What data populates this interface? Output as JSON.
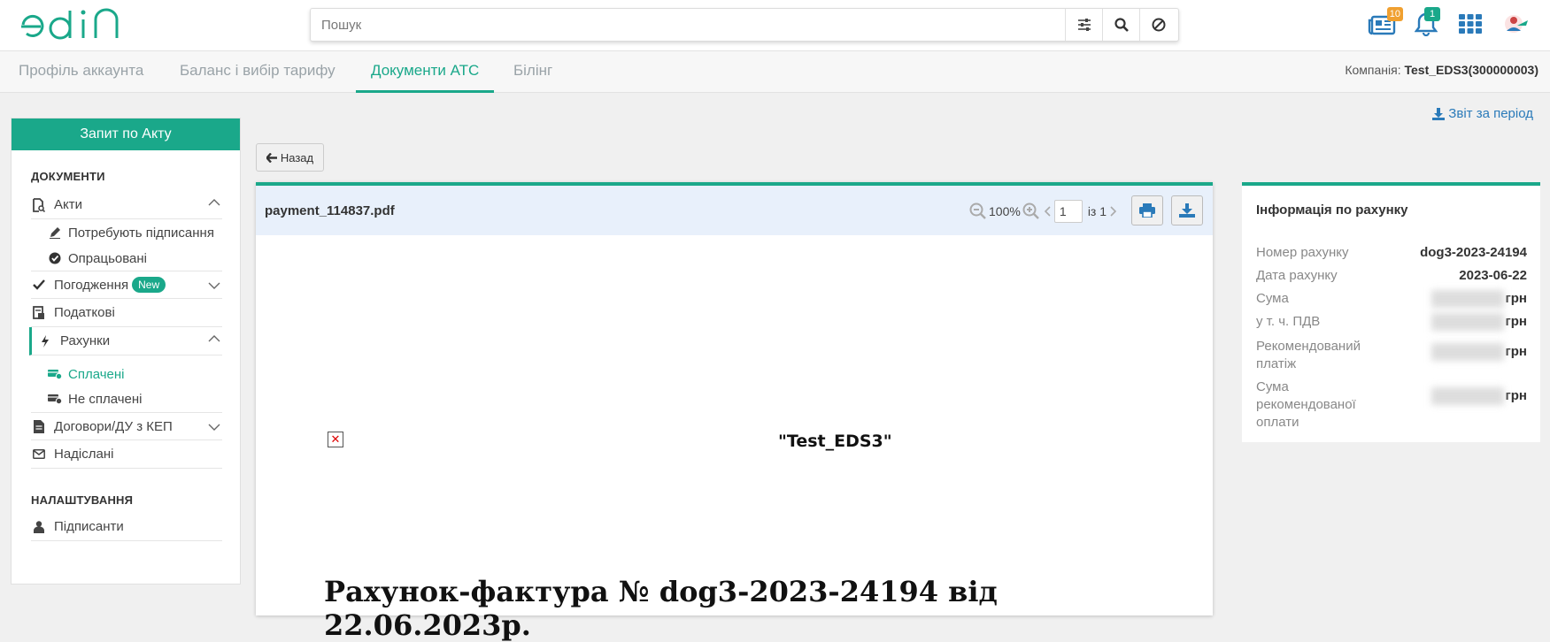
{
  "brand": {
    "logo_text": "edin",
    "accent": "#1aa88a"
  },
  "search": {
    "placeholder": "Пошук"
  },
  "topbar": {
    "news_badge": "10",
    "notif_badge": "1"
  },
  "tabs": [
    {
      "label": "Профіль аккаунта"
    },
    {
      "label": "Баланс і вибір тарифу"
    },
    {
      "label": "Документи АТС"
    },
    {
      "label": "Білінг"
    }
  ],
  "company": {
    "label": "Компанія:",
    "value": "Test_EDS3(300000003)"
  },
  "sidebar": {
    "request_button": "Запит по Акту",
    "documents_heading": "ДОКУМЕНТИ",
    "items": {
      "acts": "Акти",
      "need_sign": "Потребують підписання",
      "processed": "Опрацьовані",
      "approvals": "Погодження",
      "new_badge": "New",
      "tax": "Податкові",
      "invoices": "Рахунки",
      "paid": "Сплачені",
      "unpaid": "Не сплачені",
      "contracts": "Договори/ДУ з КЕП",
      "sent": "Надіслані"
    },
    "settings_heading": "НАЛАШТУВАННЯ",
    "signers": "Підписанти"
  },
  "back_button": "Назад",
  "report_link": "Звіт за період",
  "viewer": {
    "file_name": "payment_114837.pdf",
    "zoom": "100%",
    "page": "1",
    "page_of": "із 1",
    "doc_company": "\"Test_EDS3\"",
    "doc_title": "Рахунок-фактура № dog3-2023-24194 від  22.06.2023р."
  },
  "info": {
    "heading": "Інформація по рахунку",
    "rows": [
      {
        "label": "Номер рахунку",
        "value": "dog3-2023-24194"
      },
      {
        "label": "Дата рахунку",
        "value": "2023-06-22"
      },
      {
        "label": "Сума",
        "value": "грн"
      },
      {
        "label": "у т. ч. ПДВ",
        "value": "грн"
      },
      {
        "label": "Рекомендований платіж",
        "value": "грн"
      },
      {
        "label": "Сума рекомендованої оплати",
        "value": "грн"
      }
    ]
  }
}
